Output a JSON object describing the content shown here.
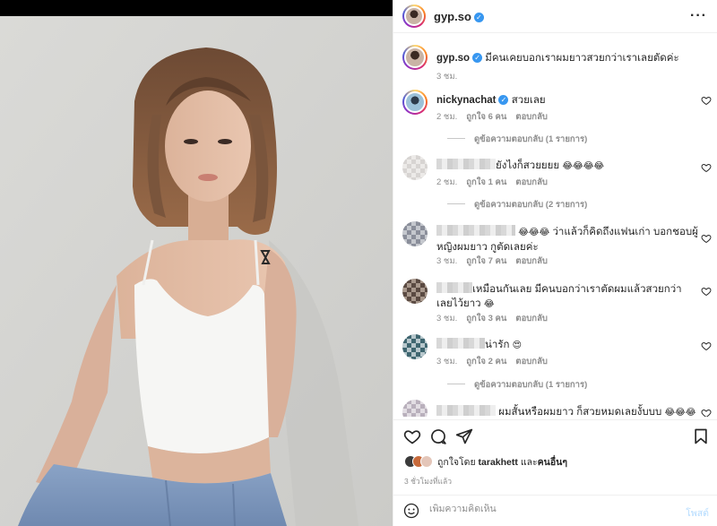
{
  "post": {
    "username": "gyp.so",
    "verified_mark": "✓",
    "more_icon": "more-dots-icon"
  },
  "caption": {
    "username": "gyp.so",
    "text": "มีคนเคยบอกเราผมยาวสวยกว่าเราเลยตัดค่ะ",
    "time": "3 ชม."
  },
  "comments": [
    {
      "username": "nickynachat",
      "text": "สวยเลย",
      "time": "2 ชม.",
      "likes": "ถูกใจ 6 คน",
      "reply": "ตอบกลับ",
      "view_replies": "ดูข้อความตอบกลับ (1 รายการ)"
    },
    {
      "username": "",
      "text": "ยังไงก็สวยยยย",
      "emoji": "😂😂😂😂",
      "time": "2 ชม.",
      "likes": "ถูกใจ 1 คน",
      "reply": "ตอบกลับ",
      "view_replies": "ดูข้อความตอบกลับ (2 รายการ)"
    },
    {
      "username": "",
      "emoji_lead": "😂😂😂",
      "text": "ว่าแล้วก็คิดถึงแฟนเก่า บอกชอบผู้หญิงผมยาว กูตัดเลยค่ะ",
      "time": "3 ชม.",
      "likes": "ถูกใจ 7 คน",
      "reply": "ตอบกลับ"
    },
    {
      "username": "",
      "text": "เหมือนกันเลย มีคนบอกว่าเราตัดผมแล้วสวยกว่า เลยไว้ยาว",
      "emoji": "😂",
      "time": "3 ชม.",
      "likes": "ถูกใจ 3 คน",
      "reply": "ตอบกลับ"
    },
    {
      "username": "",
      "text": "น่ารัก",
      "emoji": "😍",
      "time": "3 ชม.",
      "likes": "ถูกใจ 2 คน",
      "reply": "ตอบกลับ",
      "view_replies": "ดูข้อความตอบกลับ (1 รายการ)"
    },
    {
      "username": "",
      "text": "ผมสั้นหรือผมยาว ก็สวยหมดเลยงั้บบบ",
      "emoji": "😂😂😂"
    }
  ],
  "footer": {
    "liked_by_prefix": "ถูกใจโดย",
    "liked_by_user": "tarakhett",
    "liked_by_suffix": "และ",
    "liked_by_others": "คนอื่นๆ",
    "time": "3 ชั่วโมงที่แล้ว",
    "comment_placeholder": "เพิ่มความคิดเห็น",
    "post_label": "โพสต์"
  },
  "colors": {
    "accent": "#3897f0",
    "post_disabled": "#b3dbff",
    "muted": "#8e8e8e"
  }
}
